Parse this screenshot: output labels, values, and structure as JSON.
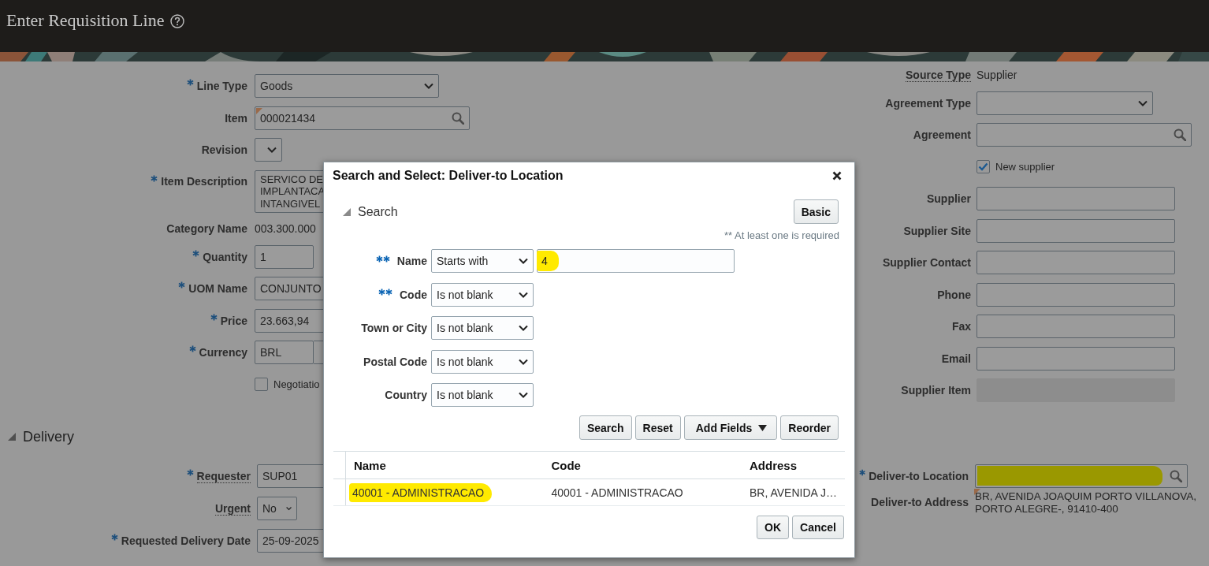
{
  "header": {
    "title": "Enter Requisition Line"
  },
  "line_form": {
    "fields": [
      {
        "label": "Line Type",
        "required": true,
        "kind": "select",
        "value": "Goods"
      },
      {
        "label": "Item",
        "required": false,
        "kind": "lookup",
        "value": "000021434",
        "flagged": true
      },
      {
        "label": "Revision",
        "required": false,
        "kind": "select"
      },
      {
        "label": "Item Description",
        "required": true,
        "kind": "textarea",
        "lines": [
          "SERVICO DE",
          "IMPLANTACA",
          "INTANGIVEL"
        ]
      },
      {
        "label": "Category Name",
        "required": false,
        "kind": "readonly",
        "value": "003.300.000"
      },
      {
        "label": "Quantity",
        "required": true,
        "kind": "text",
        "value": "1"
      },
      {
        "label": "UOM Name",
        "required": true,
        "kind": "text",
        "value": "CONJUNTO"
      },
      {
        "label": "Price",
        "required": true,
        "kind": "text",
        "value": "23.663,94"
      },
      {
        "label": "Currency",
        "required": true,
        "kind": "currency",
        "value": "BRL"
      },
      {
        "required": false,
        "kind": "checkbox",
        "value": "Negotiatio",
        "checked": false
      }
    ]
  },
  "source_form": {
    "fields": [
      {
        "label": "Source Type",
        "required": false,
        "help_link": true,
        "kind": "readonly",
        "value": "Supplier"
      },
      {
        "label": "Agreement Type",
        "required": false,
        "kind": "select"
      },
      {
        "label": "Agreement",
        "required": false,
        "kind": "lookup"
      },
      {
        "required": false,
        "kind": "checkbox",
        "value": "New supplier",
        "checked": true
      },
      {
        "label": "Supplier",
        "required": false,
        "kind": "text"
      },
      {
        "label": "Supplier Site",
        "required": false,
        "kind": "text"
      },
      {
        "label": "Supplier Contact",
        "required": false,
        "kind": "text"
      },
      {
        "label": "Phone",
        "required": false,
        "kind": "text"
      },
      {
        "label": "Fax",
        "required": false,
        "kind": "text"
      },
      {
        "label": "Email",
        "required": false,
        "kind": "text"
      },
      {
        "label": "Supplier Item",
        "required": false,
        "kind": "disabled"
      }
    ]
  },
  "delivery": {
    "title": "Delivery",
    "expanded": true,
    "requester_fields": [
      {
        "label": "Requester",
        "required": true,
        "help_link": true,
        "kind": "text",
        "value": "SUP01"
      },
      {
        "label": "Urgent",
        "required": false,
        "help_link": true,
        "kind": "select",
        "value": "No"
      },
      {
        "label": "Requested Delivery Date",
        "required": true,
        "kind": "text",
        "value": "25-09-2025"
      }
    ],
    "location_fields": [
      {
        "label": "Deliver-to Location",
        "required": true,
        "kind": "lookup",
        "highlighted": true
      },
      {
        "label": "Deliver-to Address",
        "required": false,
        "kind": "address",
        "flagged": true,
        "lines": [
          "BR, AVENIDA JOAQUIM PORTO VILLANOVA,",
          "PORTO ALEGRE-, 91410-400"
        ]
      }
    ]
  },
  "dialog": {
    "title": "Search and Select: Deliver-to Location",
    "search_section": {
      "title": "Search",
      "expanded": true
    },
    "mode_button": "Basic",
    "hint": "** At least one is required",
    "criteria": [
      {
        "label": "Name",
        "required_group": true,
        "operator": "Starts with",
        "value": "4",
        "highlighted": true
      },
      {
        "label": "Code",
        "required_group": true,
        "operator": "Is not blank"
      },
      {
        "label": "Town or City",
        "required_group": false,
        "operator": "Is not blank"
      },
      {
        "label": "Postal Code",
        "required_group": false,
        "operator": "Is not blank"
      },
      {
        "label": "Country",
        "required_group": false,
        "operator": "Is not blank"
      }
    ],
    "actions": [
      {
        "label": "Search",
        "kind": "button"
      },
      {
        "label": "Reset",
        "kind": "button"
      },
      {
        "label": "Add Fields",
        "kind": "menu"
      },
      {
        "label": "Reorder",
        "kind": "button"
      }
    ],
    "table": {
      "columns": [
        "Name",
        "Code",
        "Address"
      ],
      "rows": [
        {
          "cells": [
            {
              "text": "40001 - ADMINISTRACAO",
              "highlighted": true
            },
            {
              "text": "40001 - ADMINISTRACAO",
              "highlighted": false
            },
            {
              "text": "BR, AVENIDA J…",
              "highlighted": false
            }
          ]
        }
      ]
    },
    "footer_buttons": [
      "OK",
      "Cancel"
    ]
  }
}
